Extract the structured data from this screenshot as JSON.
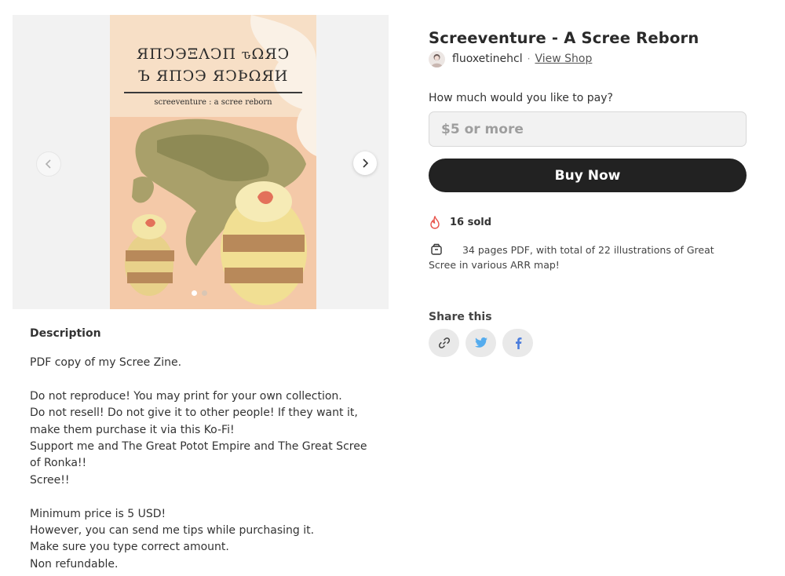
{
  "product": {
    "title": "Screeventure - A Scree Reborn",
    "creator_name": "fluoxetinehcl",
    "separator": "·",
    "view_shop_label": "View Shop"
  },
  "gallery": {
    "cover_line1": "ЯΠϽЭΞΛϽΠ ԏΩЯϽ",
    "cover_line2": "Ъ ЯΠϽЭ ЯϽϷΩЯИ",
    "cover_subtitle": "screeventure : a scree reborn",
    "prev_icon": "chevron-left-icon",
    "next_icon": "chevron-right-icon",
    "slide_count": 2,
    "active_slide": 1
  },
  "payment": {
    "label": "How much would you like to pay?",
    "placeholder": "$5 or more",
    "value": "",
    "buy_label": "Buy Now"
  },
  "stats": {
    "sold_icon": "flame-icon",
    "sold_text": "16 sold",
    "info_icon": "package-icon",
    "info_text": "34 pages PDF, with total of 22 illustrations of Great Scree in various ARR map!"
  },
  "share": {
    "label": "Share this",
    "buttons": [
      {
        "name": "copy-link",
        "icon": "link-icon"
      },
      {
        "name": "twitter",
        "icon": "twitter-icon",
        "color": "#55acee"
      },
      {
        "name": "facebook",
        "icon": "facebook-icon",
        "color": "#4a7cdc"
      }
    ]
  },
  "description": {
    "heading": "Description",
    "lines": [
      "PDF copy of my Scree Zine.",
      "",
      "Do not reproduce! You may print for your own collection.",
      "Do not resell! Do not give it to other people! If they want it, make them purchase it via this Ko-Fi!",
      "Support me and The Great Potot Empire and The Great Scree of Ronka!!",
      "Scree!!",
      "",
      "Minimum price is 5 USD!",
      "However, you can send me tips while purchasing it.",
      "Make sure you type correct amount.",
      "Non refundable."
    ]
  },
  "colors": {
    "accent": "#222222",
    "cover_bg": "#f4c9a8",
    "flame": "#e8524a"
  }
}
